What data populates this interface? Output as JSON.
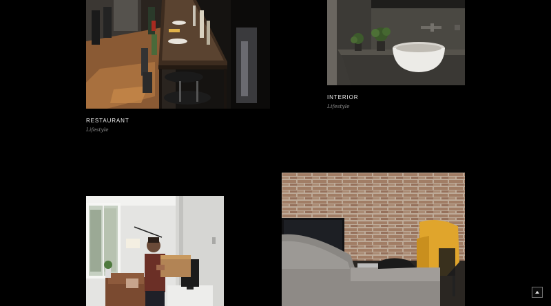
{
  "portfolio": {
    "items": [
      {
        "title": "RESTAURANT",
        "category": "Lifestyle",
        "image": "restaurant-bar-photo"
      },
      {
        "title": "INTERIOR",
        "category": "Lifestyle",
        "image": "bathroom-sink-photo"
      },
      {
        "title": "",
        "category": "",
        "image": "man-carrying-box-photo"
      },
      {
        "title": "",
        "category": "",
        "image": "brick-wall-living-room-photo"
      }
    ]
  },
  "back_to_top": {
    "icon": "chevron-up-icon"
  },
  "colors": {
    "background": "#000000",
    "title": "#f2f2f2",
    "category": "#8c8c8c"
  }
}
